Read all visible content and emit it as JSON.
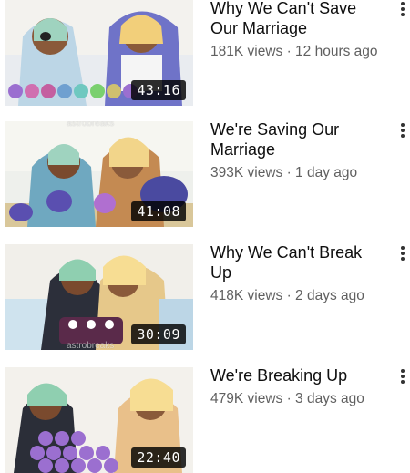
{
  "videos": [
    {
      "title": "Why We Can't Save Our Marriage",
      "views": "181K views",
      "age": "12 hours ago",
      "duration": "43:16",
      "watermark": ""
    },
    {
      "title": "We're Saving Our Marriage",
      "views": "393K views",
      "age": "1 day ago",
      "duration": "41:08",
      "watermark": "astrobreaks"
    },
    {
      "title": "Why We Can't Break Up",
      "views": "418K views",
      "age": "2 days ago",
      "duration": "30:09",
      "watermark": "astrobreaks"
    },
    {
      "title": "We're Breaking Up",
      "views": "479K views",
      "age": "3 days ago",
      "duration": "22:40",
      "watermark": ""
    }
  ],
  "separator": " · ",
  "icons": {
    "more": "kebab-menu-icon"
  }
}
